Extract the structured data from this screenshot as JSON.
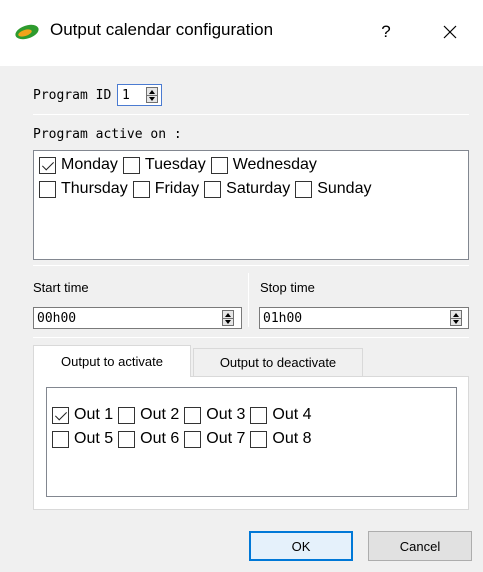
{
  "window": {
    "title": "Output calendar configuration",
    "help_label": "?",
    "icon": "app-leaf-icon",
    "close_icon": "close-icon"
  },
  "program": {
    "id_label": "Program ID",
    "id_value": "1"
  },
  "days": {
    "label": "Program active on :",
    "rows": [
      [
        {
          "label": "Monday",
          "checked": true
        },
        {
          "label": "Tuesday",
          "checked": false
        },
        {
          "label": "Wednesday",
          "checked": false
        }
      ],
      [
        {
          "label": "Thursday",
          "checked": false
        },
        {
          "label": "Friday",
          "checked": false
        },
        {
          "label": "Saturday",
          "checked": false
        },
        {
          "label": "Sunday",
          "checked": false
        }
      ]
    ]
  },
  "time": {
    "start_label": "Start time",
    "start_value": "00h00",
    "stop_label": "Stop time",
    "stop_value": "01h00"
  },
  "tabs": [
    {
      "label": "Output to activate",
      "active": true
    },
    {
      "label": "Output to deactivate",
      "active": false
    }
  ],
  "outputs": {
    "rows": [
      [
        {
          "label": "Out 1",
          "checked": true
        },
        {
          "label": "Out 2",
          "checked": false
        },
        {
          "label": "Out 3",
          "checked": false
        },
        {
          "label": "Out 4",
          "checked": false
        }
      ],
      [
        {
          "label": "Out 5",
          "checked": false
        },
        {
          "label": "Out 6",
          "checked": false
        },
        {
          "label": "Out 7",
          "checked": false
        },
        {
          "label": "Out 8",
          "checked": false
        }
      ]
    ]
  },
  "buttons": {
    "ok": "OK",
    "cancel": "Cancel"
  },
  "colors": {
    "focus_blue": "#0078d7",
    "window_bg": "#f0f0f0",
    "icon_green": "#2e9b2e",
    "icon_orange": "#f2a31b"
  }
}
